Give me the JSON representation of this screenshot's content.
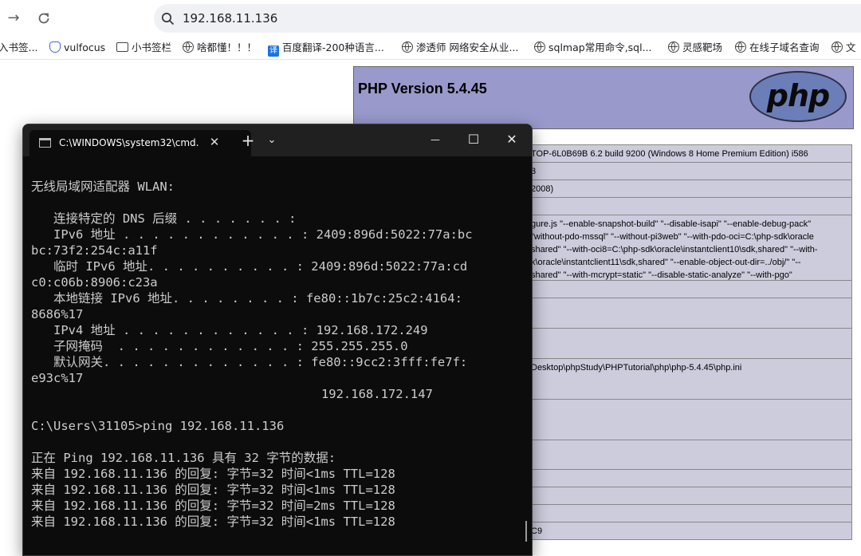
{
  "browser": {
    "url": "192.168.11.136",
    "bookmarks": [
      {
        "label": "入书签...",
        "icon": "none"
      },
      {
        "label": "vulfocus",
        "icon": "shield-icon"
      },
      {
        "label": "小书签栏",
        "icon": "folder-icon"
      },
      {
        "label": "啥都懂！！！",
        "icon": "globe-icon"
      },
      {
        "label": "百度翻译-200种语言...",
        "icon": "translate-icon"
      },
      {
        "label": "渗透师 网络安全从业...",
        "icon": "globe-icon"
      },
      {
        "label": "sqlmap常用命令,sql...",
        "icon": "globe-icon"
      },
      {
        "label": "灵感靶场",
        "icon": "globe-icon"
      },
      {
        "label": "在线子域名查询",
        "icon": "globe-icon"
      },
      {
        "label": "文",
        "icon": "globe-icon"
      }
    ]
  },
  "phpinfo": {
    "version_title": "PHP Version 5.4.45",
    "logo_text": "php",
    "rows": [
      "TOP-6L0B69B 6.2 build 9200 (Windows 8 Home Premium Edition) i586",
      "3",
      " 2008)",
      "",
      "gure.js \"--enable-snapshot-build\" \"--disable-isapi\" \"--enable-debug-pack\"\n\"without-pdo-mssql\" \"--without-pi3web\" \"--with-pdo-oci=C:\\php-sdk\\oracle\nshared\" \"--with-oci8=C:\\php-sdk\\oracle\\instantclient10\\sdk,shared\" \"--with-\nk\\oracle\\instantclient11\\sdk,shared\" \"--enable-object-out-dir=../obj/\" \"--\nshared\" \"--with-mcrypt=static\" \"--disable-static-analyze\" \"--with-pgo\"",
      "",
      "",
      "",
      "Desktop\\phpStudy\\PHPTutorial\\php\\php-5.4.45\\php.ini",
      "",
      "",
      "",
      "",
      "",
      "",
      "C9"
    ]
  },
  "terminal": {
    "tab_title": "C:\\WINDOWS\\system32\\cmd.",
    "new_tab": "+",
    "dropdown": "⌄",
    "minimize": "—",
    "maximize": "☐",
    "close": "✕",
    "lines": [
      "无线局域网适配器 WLAN:",
      "",
      "   连接特定的 DNS 后缀 . . . . . . . :",
      "   IPv6 地址 . . . . . . . . . . . . : 2409:896d:5022:77a:bc",
      "bc:73f2:254c:a11f",
      "   临时 IPv6 地址. . . . . . . . . . : 2409:896d:5022:77a:cd",
      "c0:c06b:8906:c23a",
      "   本地链接 IPv6 地址. . . . . . . . : fe80::1b7c:25c2:4164:",
      "8686%17",
      "   IPv4 地址 . . . . . . . . . . . . : 192.168.172.249",
      "   子网掩码  . . . . . . . . . . . . : 255.255.255.0",
      "   默认网关. . . . . . . . . . . . . : fe80::9cc2:3fff:fe7f:",
      "e93c%17",
      "                                       192.168.172.147",
      "",
      "C:\\Users\\31105>ping 192.168.11.136",
      "",
      "正在 Ping 192.168.11.136 具有 32 字节的数据:",
      "来自 192.168.11.136 的回复: 字节=32 时间<1ms TTL=128",
      "来自 192.168.11.136 的回复: 字节=32 时间<1ms TTL=128",
      "来自 192.168.11.136 的回复: 字节=32 时间=2ms TTL=128",
      "来自 192.168.11.136 的回复: 字节=32 时间<1ms TTL=128"
    ]
  }
}
